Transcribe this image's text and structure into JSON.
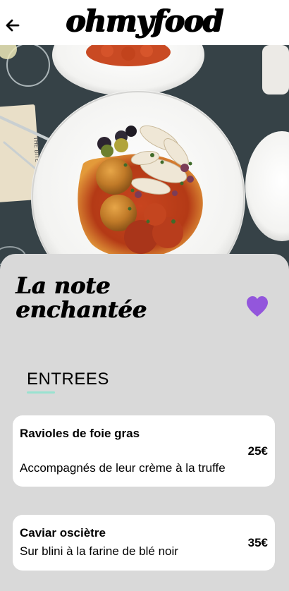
{
  "header": {
    "logo": "ohmyfood",
    "back_icon": "arrow-left-icon"
  },
  "hero": {
    "image_subject": "plated dish with arancini, squid, olives and tomato sauce"
  },
  "restaurant": {
    "name": "La note\nenchantée",
    "favorite_icon": "heart-icon",
    "accent_color": "#9356dc"
  },
  "menu": {
    "section_title": "ENTREES",
    "section_underline_color": "#99e2d0",
    "dishes": [
      {
        "name": "Ravioles de foie gras",
        "description": "Accompagnés de leur crème à la truffe",
        "price": "25€"
      },
      {
        "name": "Caviar osciètre",
        "description": "Sur blini à la farine de blé noir",
        "price": "35€"
      }
    ]
  }
}
